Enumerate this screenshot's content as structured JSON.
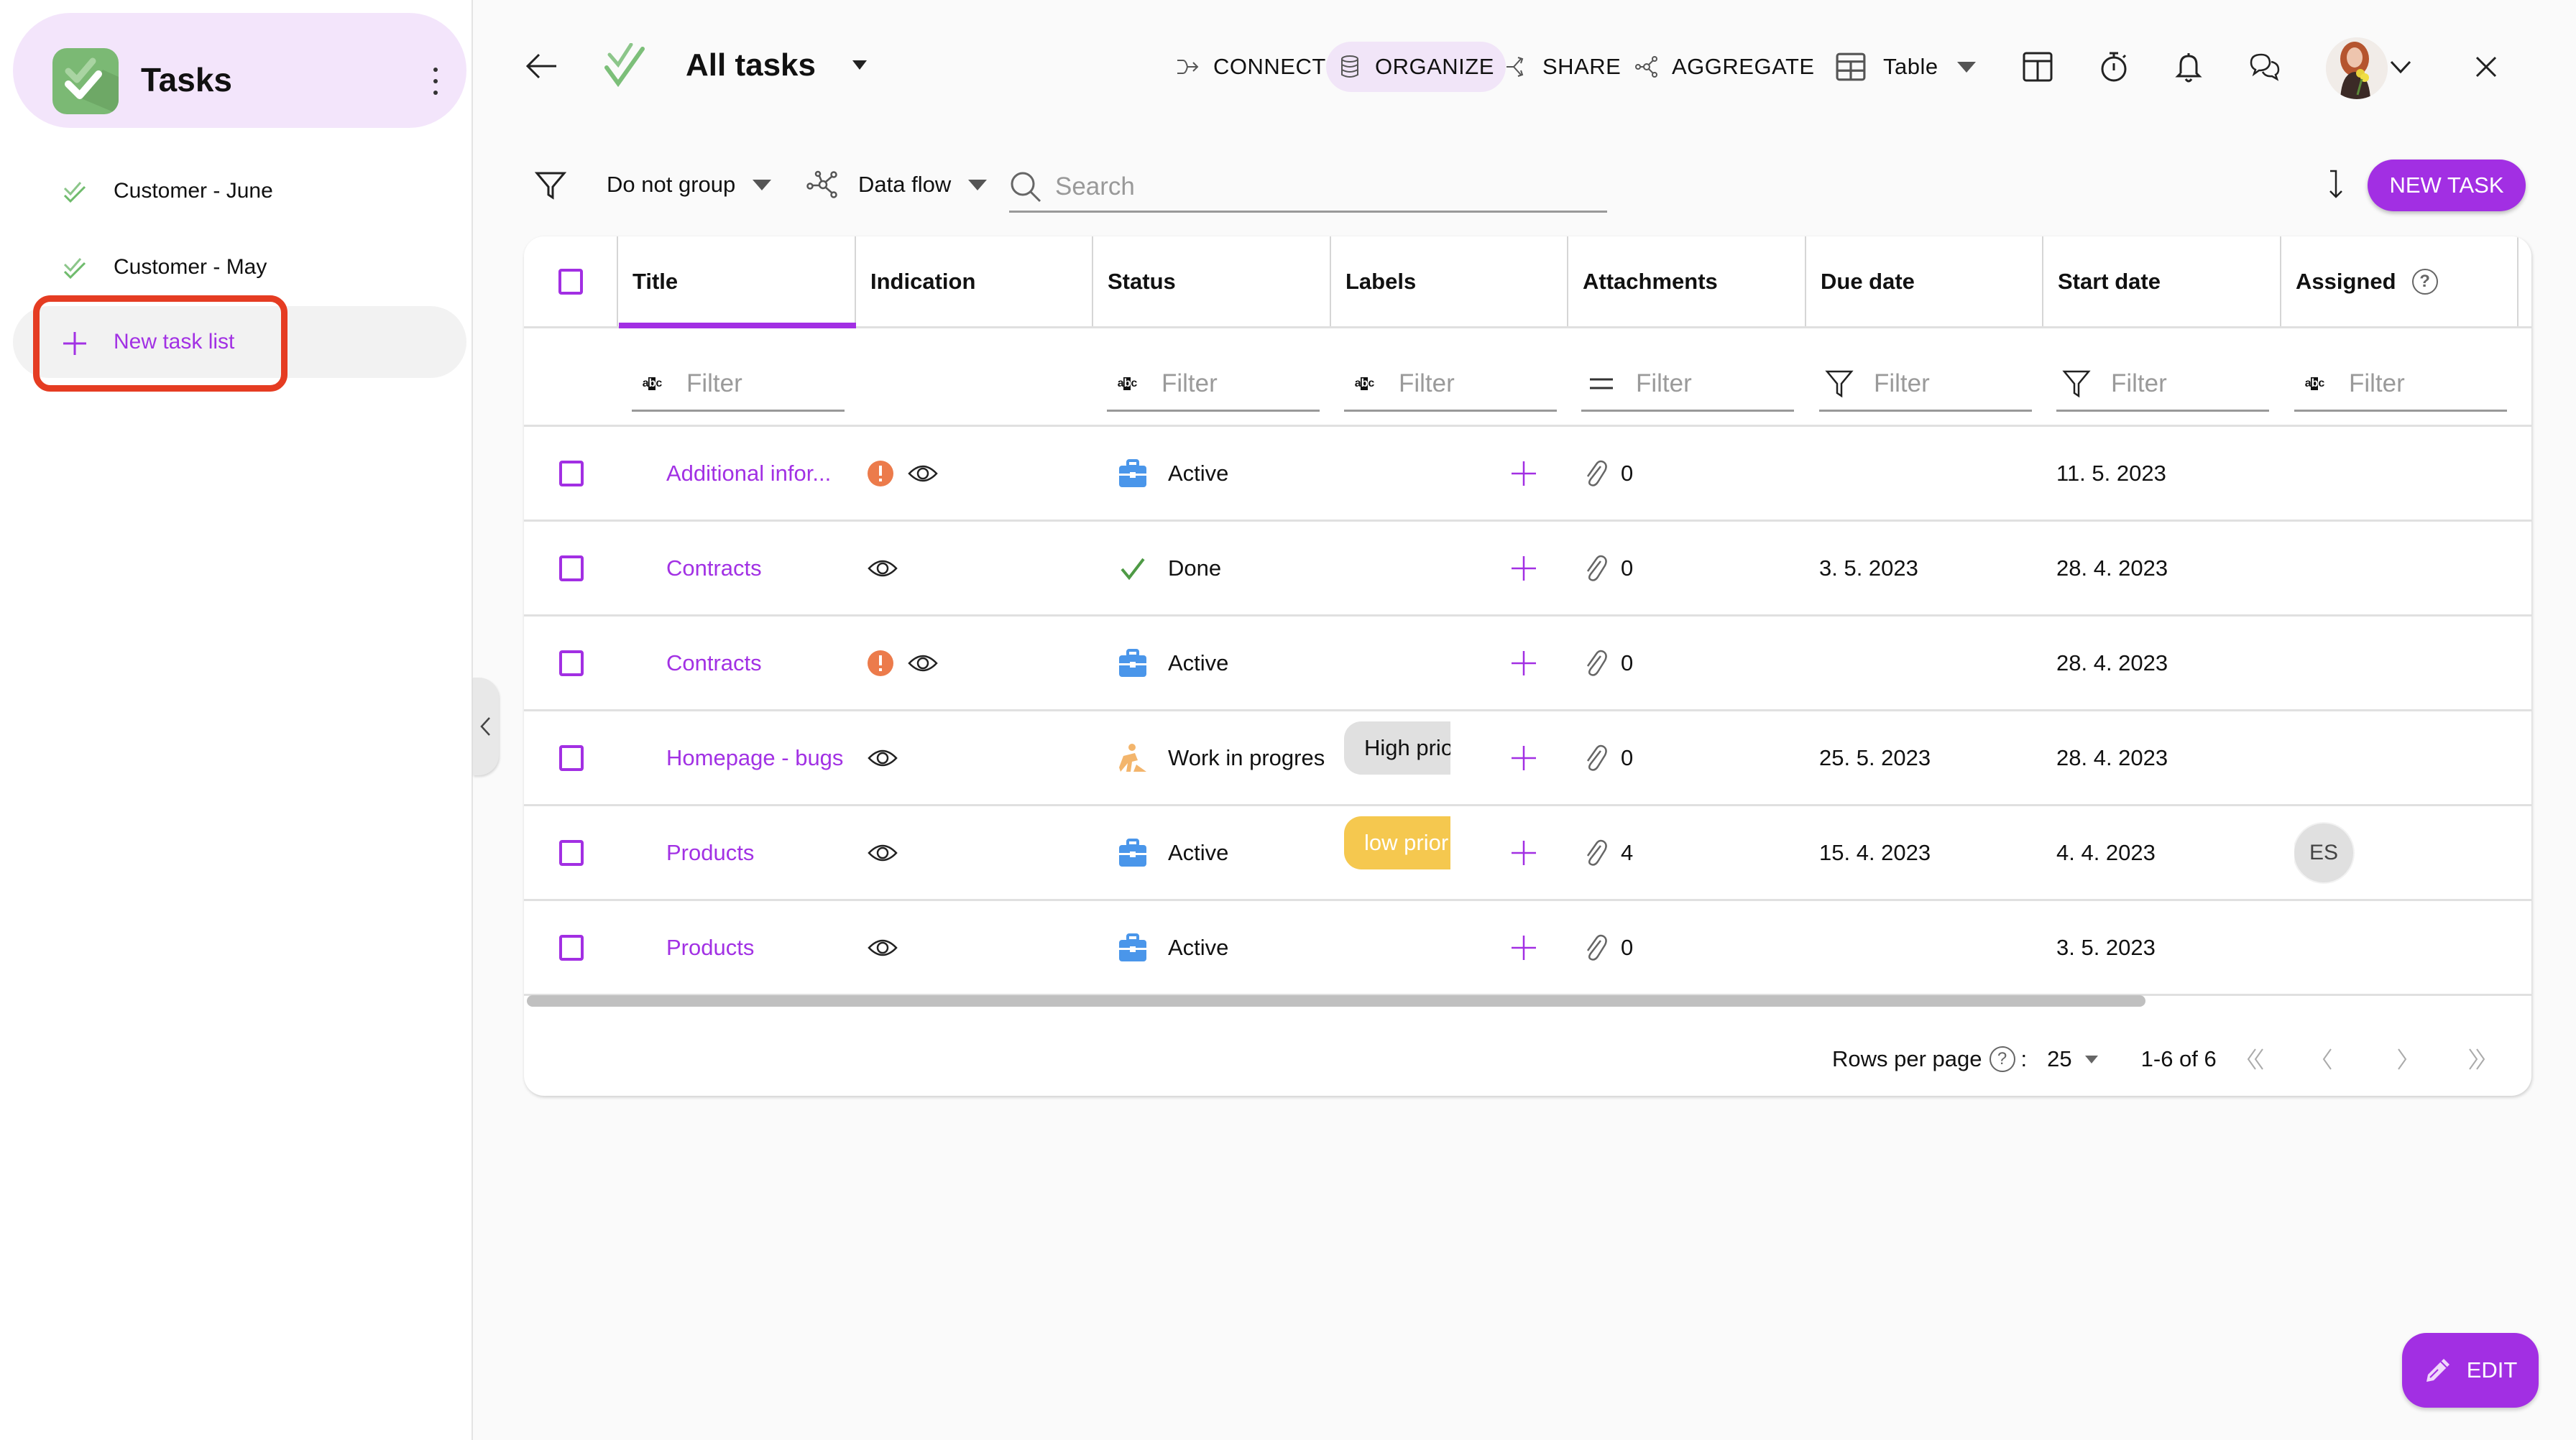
{
  "sidebar": {
    "app_title": "Tasks",
    "items": [
      {
        "label": "Customer - June",
        "icon": "double-check-icon"
      },
      {
        "label": "Customer - May",
        "icon": "double-check-icon"
      }
    ],
    "new_list_label": "New task list"
  },
  "header": {
    "title": "All tasks",
    "actions": [
      {
        "label": "CONNECT",
        "icon": "connect-icon",
        "selected": false
      },
      {
        "label": "ORGANIZE",
        "icon": "database-icon",
        "selected": true
      },
      {
        "label": "SHARE",
        "icon": "share-icon",
        "selected": false
      },
      {
        "label": "AGGREGATE",
        "icon": "aggregate-icon",
        "selected": false
      }
    ],
    "view_label": "Table"
  },
  "toolbar": {
    "group_label": "Do not group",
    "flow_label": "Data flow",
    "search_placeholder": "Search",
    "search_value": "",
    "new_task_label": "NEW TASK"
  },
  "table": {
    "columns": [
      "Title",
      "Indication",
      "Status",
      "Labels",
      "Attachments",
      "Due date",
      "Start date",
      "Assigned"
    ],
    "filter_placeholder": "Filter",
    "rows": [
      {
        "title": "Additional infor...",
        "alert": true,
        "status": "Active",
        "status_icon": "briefcase-icon",
        "label": "",
        "label_color": "",
        "attachments": "0",
        "due": "",
        "start": "11. 5. 2023",
        "assigned": ""
      },
      {
        "title": "Contracts",
        "alert": false,
        "status": "Done",
        "status_icon": "check-icon",
        "label": "",
        "label_color": "",
        "attachments": "0",
        "due": "3. 5. 2023",
        "start": "28. 4. 2023",
        "assigned": ""
      },
      {
        "title": "Contracts",
        "alert": true,
        "status": "Active",
        "status_icon": "briefcase-icon",
        "label": "",
        "label_color": "",
        "attachments": "0",
        "due": "",
        "start": "28. 4. 2023",
        "assigned": ""
      },
      {
        "title": "Homepage - bugs",
        "alert": false,
        "status": "Work in progres",
        "status_icon": "worker-icon",
        "label": "High prio",
        "label_color": "#e0e0e0",
        "attachments": "0",
        "due": "25. 5. 2023",
        "start": "28. 4. 2023",
        "assigned": ""
      },
      {
        "title": "Products",
        "alert": false,
        "status": "Active",
        "status_icon": "briefcase-icon",
        "label": "low prior",
        "label_color": "#f5c84f",
        "attachments": "4",
        "due": "15. 4. 2023",
        "start": "4. 4. 2023",
        "assigned": "ES"
      },
      {
        "title": "Products",
        "alert": false,
        "status": "Active",
        "status_icon": "briefcase-icon",
        "label": "",
        "label_color": "",
        "attachments": "0",
        "due": "",
        "start": "3. 5. 2023",
        "assigned": ""
      }
    ]
  },
  "pagination": {
    "rows_per_page_label": "Rows per page",
    "rows_per_page": "25",
    "range": "1-6 of 6"
  },
  "edit_label": "EDIT",
  "colors": {
    "accent": "#a22fe3",
    "alert": "#ec7b4b",
    "active": "#4a96ea",
    "done": "#4e9a45",
    "wip": "#f3b56c"
  }
}
